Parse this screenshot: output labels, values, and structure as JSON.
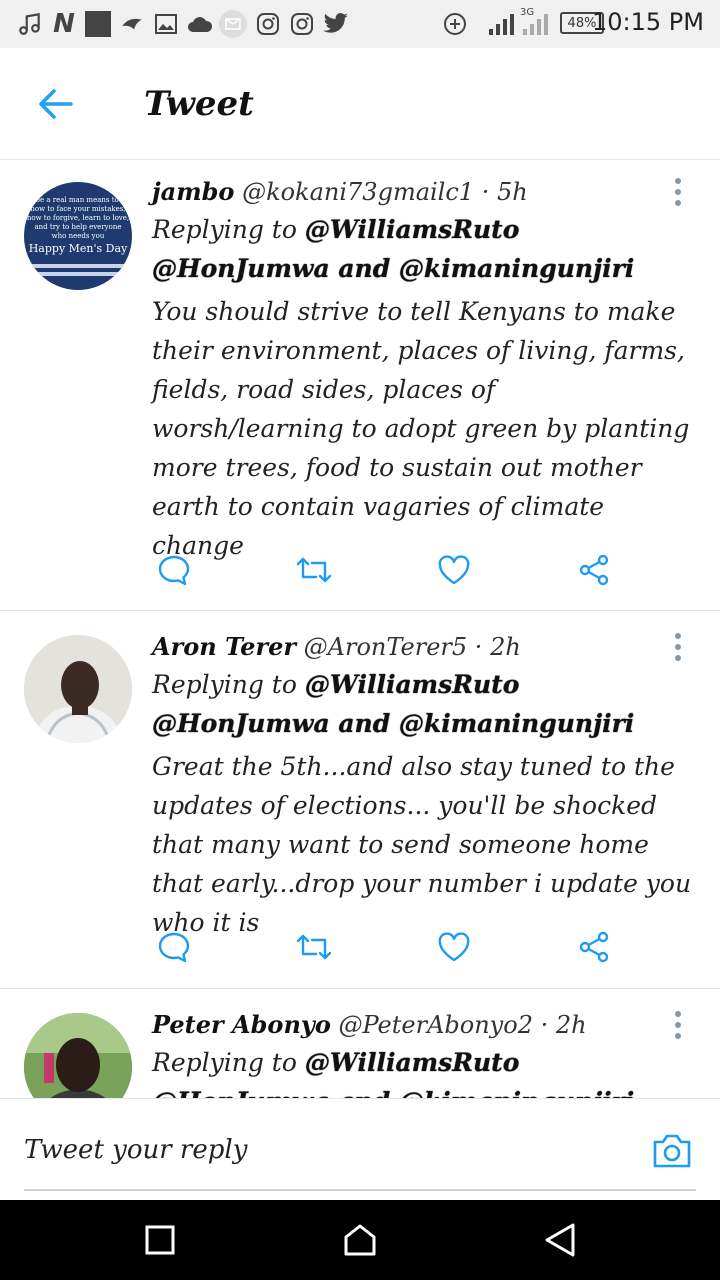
{
  "status_bar": {
    "time": "10:15 PM",
    "battery": "48%",
    "network": "3G",
    "icons": [
      "music-icon",
      "n-icon",
      "square-icon",
      "bird-icon",
      "image-icon",
      "cloud-icon",
      "mail-icon",
      "instagram-icon",
      "instagram-icon",
      "twitter-icon",
      "add-circle-icon",
      "signal-icon",
      "signal-icon",
      "battery-icon"
    ]
  },
  "header": {
    "title": "Tweet",
    "back_icon": "arrow-left-icon"
  },
  "tweets": [
    {
      "name": "jambo",
      "handle": "@kokani73gmailc1",
      "time": "5h",
      "replying_prefix": "Replying to",
      "replying_to": "@WilliamsRuto @HonJumwa and @kimaningunjiri",
      "text": "You should strive to tell Kenyans to make their environment, places of living, farms, fields, road sides, places of worsh/learning to adopt green by planting more trees, food to sustain out mother earth to contain vagaries of climate  change",
      "avatar_text": {
        "line1": "to be a real man means to kn",
        "line2": "how to face your mistakes,",
        "line3": "how to forgive, learn to love,",
        "line4": "and try to help everyone",
        "line5": "who needs you",
        "banner": "Happy Men's Day"
      }
    },
    {
      "name": "Aron Terer",
      "handle": "@AronTerer5",
      "time": "2h",
      "replying_prefix": "Replying to",
      "replying_to": "@WilliamsRuto @HonJumwa and @kimaningunjiri",
      "text": "Great the 5th...and also stay tuned to the updates of elections... you'll be shocked that many want to send someone home that early...drop your number i update you who it is"
    },
    {
      "name": "Peter Abonyo",
      "handle": "@PeterAbonyo2",
      "time": "2h",
      "replying_prefix": "Replying to",
      "replying_to": "@WilliamsRuto @HonJumwa and @kimaningunjiri",
      "text": ""
    }
  ],
  "composer": {
    "placeholder": "Tweet your reply",
    "camera_icon": "camera-icon"
  },
  "colors": {
    "accent": "#1da1f2",
    "icon_gray": "#657786",
    "divider": "#e1e8ed"
  },
  "nav_bar": {
    "buttons": [
      "recents-square-icon",
      "home-icon",
      "back-triangle-icon"
    ]
  }
}
